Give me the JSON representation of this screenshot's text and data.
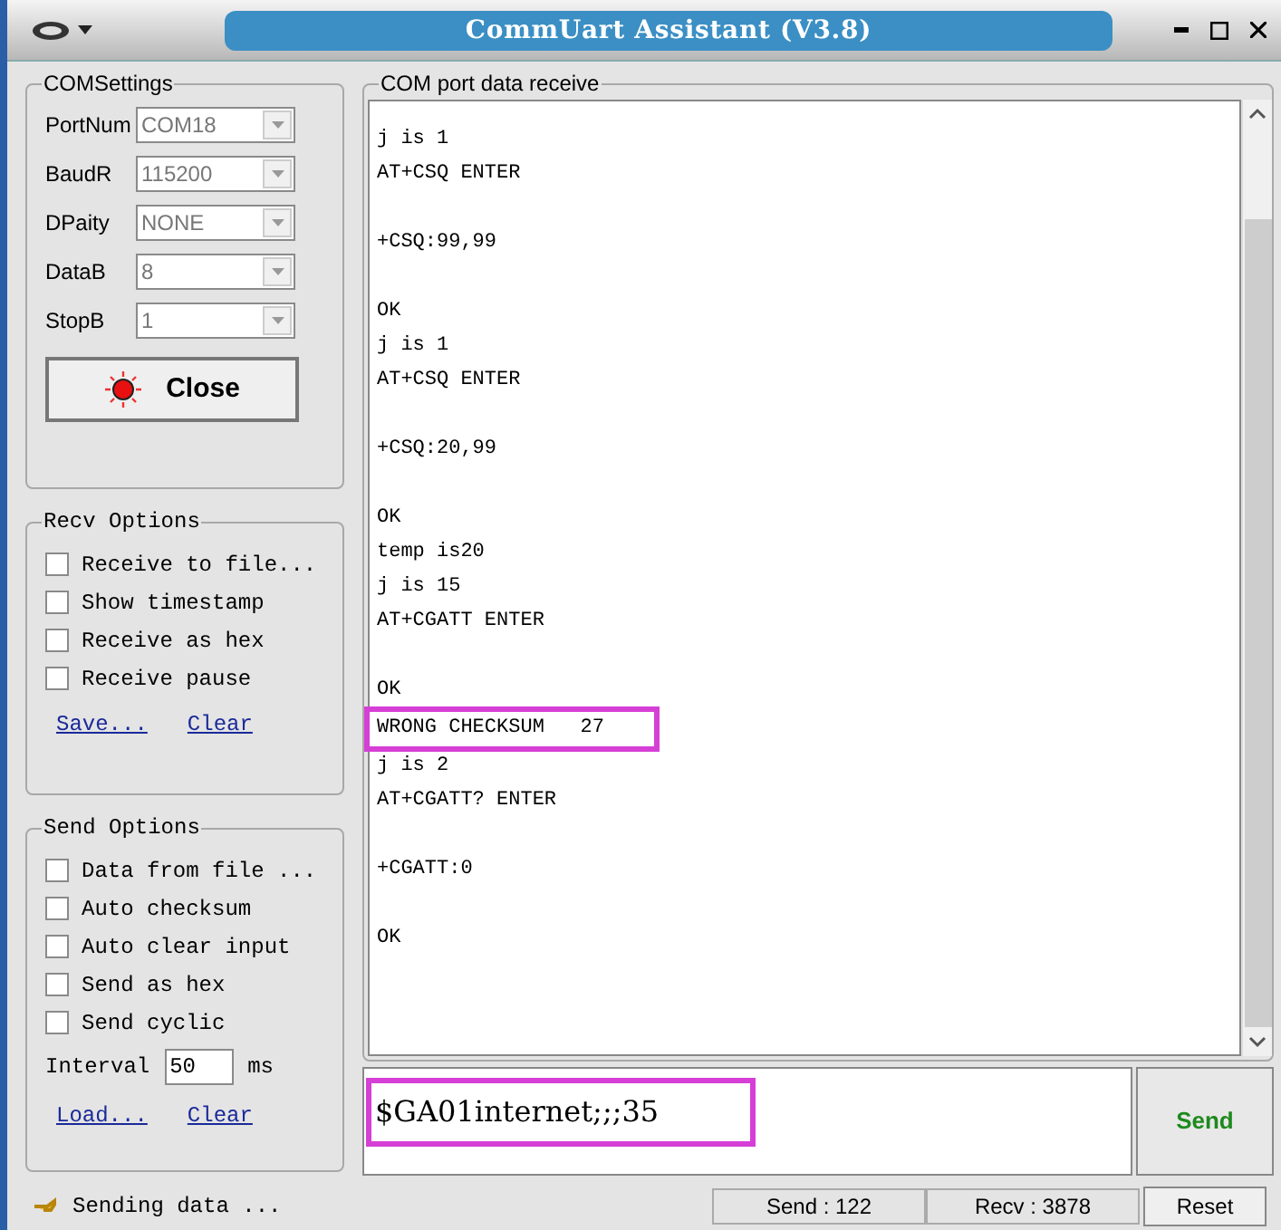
{
  "window": {
    "title": "CommUart Assistant (V3.8)"
  },
  "com_settings": {
    "title": "COMSettings",
    "fields": [
      {
        "label": "PortNum",
        "value": "COM18"
      },
      {
        "label": "BaudR",
        "value": "115200"
      },
      {
        "label": "DPaity",
        "value": "NONE"
      },
      {
        "label": "DataB",
        "value": "8"
      },
      {
        "label": "StopB",
        "value": "1"
      }
    ],
    "port_button": {
      "label": "Close",
      "on": true
    }
  },
  "recv_options": {
    "title": "Recv Options",
    "checkboxes": [
      {
        "label": "Receive to file...",
        "checked": false
      },
      {
        "label": "Show timestamp",
        "checked": false
      },
      {
        "label": "Receive as hex",
        "checked": false
      },
      {
        "label": "Receive pause",
        "checked": false
      }
    ],
    "links": [
      "Save...",
      "Clear"
    ]
  },
  "send_options": {
    "title": "Send Options",
    "checkboxes": [
      {
        "label": "Data from file ...",
        "checked": false
      },
      {
        "label": "Auto checksum",
        "checked": false
      },
      {
        "label": "Auto clear input",
        "checked": false
      },
      {
        "label": "Send as hex",
        "checked": false
      },
      {
        "label": "Send cyclic",
        "checked": false
      }
    ],
    "interval": {
      "label": "Interval",
      "value": "50",
      "unit": "ms"
    },
    "links": [
      "Load...",
      "Clear"
    ]
  },
  "receive": {
    "title": "COM port data receive",
    "blocks": [
      {
        "lines": [
          {
            "text": "j is 1",
            "highlighted": false
          },
          {
            "text": "AT+CSQ ENTER",
            "highlighted": false
          }
        ]
      },
      {
        "lines": [
          {
            "text": "+CSQ:99,99",
            "highlighted": false
          }
        ]
      },
      {
        "lines": [
          {
            "text": "OK",
            "highlighted": false
          },
          {
            "text": "j is 1",
            "highlighted": false
          },
          {
            "text": "AT+CSQ ENTER",
            "highlighted": false
          }
        ]
      },
      {
        "lines": [
          {
            "text": "+CSQ:20,99",
            "highlighted": false
          }
        ]
      },
      {
        "lines": [
          {
            "text": "OK",
            "highlighted": false
          },
          {
            "text": "temp is20",
            "highlighted": false
          },
          {
            "text": "j is 15",
            "highlighted": false
          },
          {
            "text": "AT+CGATT ENTER",
            "highlighted": false
          }
        ]
      },
      {
        "lines": [
          {
            "text": "OK",
            "highlighted": false
          },
          {
            "text": "WRONG CHECKSUM   27",
            "highlighted": true
          },
          {
            "text": "j is 2",
            "highlighted": false
          },
          {
            "text": "AT+CGATT? ENTER",
            "highlighted": false
          }
        ]
      },
      {
        "lines": [
          {
            "text": "+CGATT:0",
            "highlighted": false
          }
        ]
      },
      {
        "lines": [
          {
            "text": "OK",
            "highlighted": false
          }
        ]
      }
    ]
  },
  "send_input": {
    "value": "$GA01internet;;;35",
    "highlighted": true
  },
  "send_button": {
    "label": "Send"
  },
  "status_bar": {
    "message": "Sending data ...",
    "send": "Send : 122",
    "recv": "Recv : 3878",
    "reset": "Reset"
  }
}
